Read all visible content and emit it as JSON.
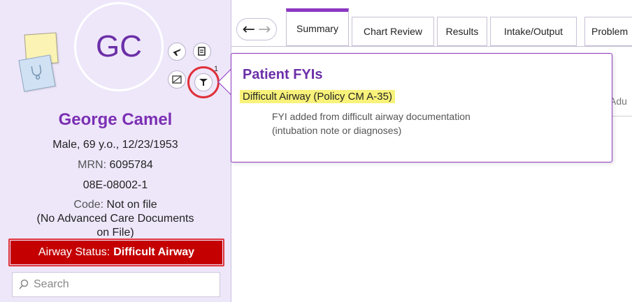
{
  "patient": {
    "initials": "GC",
    "name": "George Camel",
    "demographics": "Male, 69 y.o., 12/23/1953",
    "mrn_label": "MRN:",
    "mrn_value": "6095784",
    "encounter_id": "08E-08002-1",
    "code_label": "Code:",
    "code_value": "Not on file",
    "acp_note_line1": "(No Advanced Care Documents",
    "acp_note_line2": "on File)",
    "airway_label": "Airway Status:",
    "airway_value": "Difficult Airway"
  },
  "header_icons": {
    "fyi_count": "1",
    "names": [
      "travel-icon",
      "print-icon",
      "device-icon",
      "fyi-flag-icon"
    ]
  },
  "search": {
    "placeholder": "Search"
  },
  "tabs": [
    {
      "label": "Summary",
      "active": true
    },
    {
      "label": "Chart Review",
      "active": false
    },
    {
      "label": "Results",
      "active": false
    },
    {
      "label": "Intake/Output",
      "active": false
    },
    {
      "label": "Problem",
      "active": false
    }
  ],
  "content": {
    "partial_label": "Adu"
  },
  "fyi_popup": {
    "title": "Patient FYIs",
    "item_title": "Difficult Airway (Policy CM A-35)",
    "item_desc_line1": "FYI added from difficult airway documentation",
    "item_desc_line2": "(intubation note or diagnoses)"
  },
  "colors": {
    "sidebar_bg": "#eee7fa",
    "accent_purple": "#8c37c2",
    "name_purple": "#7b2fb3",
    "alert_red": "#c40000",
    "highlight_yellow": "#f8f27a"
  }
}
